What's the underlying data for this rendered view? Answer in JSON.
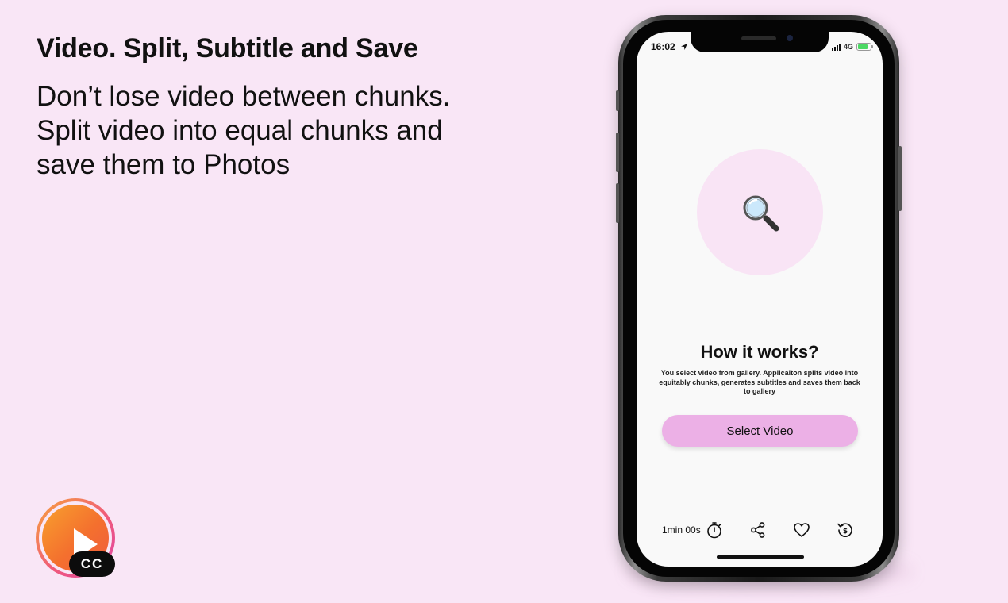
{
  "promo": {
    "headline": "Video. Split, Subtitle and Save",
    "subcopy_lines": [
      "Don’t lose video between chunks.",
      "Split video into equal chunks and",
      "save them to Photos"
    ]
  },
  "app_logo": {
    "badge": "CC",
    "icon": "play-icon",
    "colors": {
      "gradient_start": "#f8a02e",
      "gradient_end": "#ef5b3f",
      "badge_bg": "#0c0c0c"
    }
  },
  "status_bar": {
    "time": "16:02",
    "network": "4G",
    "icons": [
      "location-arrow-icon",
      "signal-bars-icon",
      "battery-charging-icon"
    ]
  },
  "main": {
    "hero_icon": "magnifying-glass-icon",
    "title": "How it works?",
    "description": "You select video from gallery. Applicaiton splits video into equitably chunks, generates subtitles and saves them back to gallery",
    "select_button_label": "Select Video"
  },
  "toolbar": {
    "duration": "1min 00s",
    "icons": [
      "timer-icon",
      "share-icon",
      "heart-icon",
      "restore-purchase-icon"
    ]
  },
  "colors": {
    "background": "#f9e6f6",
    "accent_button": "#ecb0e6",
    "hero_circle": "#f9e4f5",
    "screen": "#f9f9f9"
  }
}
